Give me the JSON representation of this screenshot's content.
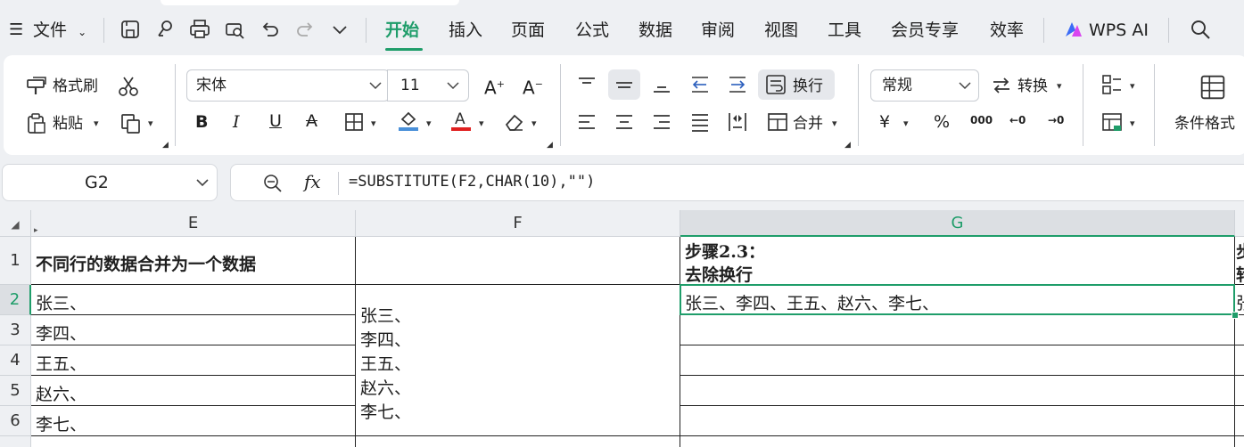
{
  "menubar": {
    "file_label": "文件",
    "tabs": [
      "开始",
      "插入",
      "页面",
      "公式",
      "数据",
      "审阅",
      "视图",
      "工具",
      "会员专享",
      "效率"
    ],
    "active_tab": "开始",
    "ai_label": "WPS AI"
  },
  "ribbon": {
    "format_painter": "格式刷",
    "paste": "粘贴",
    "font_name": "宋体",
    "font_size": "11",
    "wrap_text": "换行",
    "merge": "合并",
    "number_format": "常规",
    "convert": "转换",
    "conditional_format": "条件格式",
    "currency_symbol": "¥",
    "percent_symbol": "%",
    "thousands_symbol": "000",
    "dec_increase": "←0",
    "dec_decrease": "→0",
    "colors": {
      "underline_fill": "#4a90d9",
      "font_color": "#e02020",
      "accent": "#1f9d6a"
    }
  },
  "formula_bar": {
    "cell_ref": "G2",
    "fx": "fx",
    "formula": "=SUBSTITUTE(F2,CHAR(10),\"\")"
  },
  "sheet": {
    "columns": [
      "E",
      "F",
      "G"
    ],
    "rows": [
      "1",
      "2",
      "3",
      "4",
      "5",
      "6"
    ],
    "cells": {
      "E1": "不同行的数据合并为一个数据",
      "G1_line1": "步骤2.3：",
      "G1_line2": "去除换行",
      "E2": "张三、",
      "E3": "李四、",
      "E4": "王五、",
      "E5": "赵六、",
      "E6": "李七、",
      "F2_lines": [
        "张三、",
        "李四、",
        "王五、",
        "赵六、",
        "李七、"
      ],
      "G2": "张三、李四、王五、赵六、李七、",
      "H1_partial1": "步",
      "H1_partial2": "转",
      "H2_partial": "张"
    }
  }
}
